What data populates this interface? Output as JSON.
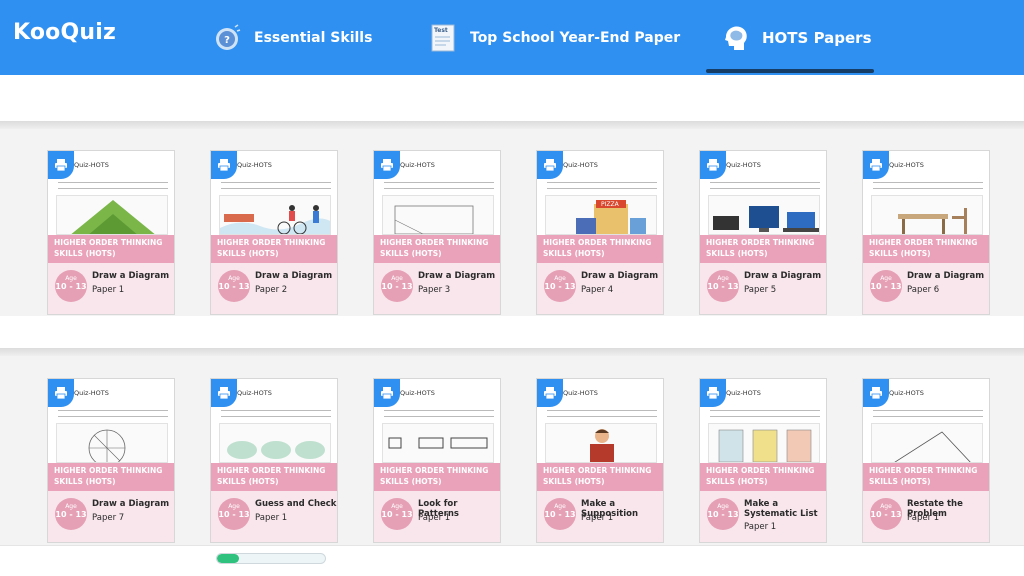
{
  "header": {
    "logo": "KooQuiz",
    "tabs": [
      {
        "label": "Essential Skills",
        "icon": "question-bubble-icon"
      },
      {
        "label": "Top School Year-End Paper",
        "icon": "test-paper-icon"
      },
      {
        "label": "HOTS Papers",
        "icon": "brain-head-icon",
        "active": true
      }
    ]
  },
  "colors": {
    "header": "#2f90f1",
    "hots_band": "#e9a2b9",
    "card_bottom": "#f8e6ec",
    "progress": "#2ec27e"
  },
  "card_common": {
    "brand": "Quiz-HOTS",
    "band_text": "HIGHER ORDER THINKING SKILLS (HOTS)",
    "age_label": "Age",
    "age_range": "10 - 13"
  },
  "cards": [
    {
      "title": "Draw a Diagram",
      "paper": "Paper 1",
      "illus": "triangle"
    },
    {
      "title": "Draw a Diagram",
      "paper": "Paper 2",
      "illus": "cyclists"
    },
    {
      "title": "Draw a Diagram",
      "paper": "Paper 3",
      "illus": "rectangle"
    },
    {
      "title": "Draw a Diagram",
      "paper": "Paper 4",
      "illus": "pizza-shop"
    },
    {
      "title": "Draw a Diagram",
      "paper": "Paper 5",
      "illus": "computers"
    },
    {
      "title": "Draw a Diagram",
      "paper": "Paper 6",
      "illus": "desk"
    },
    {
      "title": "Draw a Diagram",
      "paper": "Paper 7",
      "illus": "circle"
    },
    {
      "title": "Guess and Check",
      "paper": "Paper 1",
      "illus": "clouds"
    },
    {
      "title": "Look for Patterns",
      "paper": "Paper 1",
      "illus": "squares"
    },
    {
      "title": "Make a Supposition",
      "paper": "Paper 1",
      "illus": "person"
    },
    {
      "title": "Make a Systematic List",
      "paper": "Paper 1",
      "illus": "stamps"
    },
    {
      "title": "Restate the Problem",
      "paper": "Paper 1",
      "illus": "triangle-outline"
    }
  ],
  "progress": {
    "fraction": 0.2
  }
}
